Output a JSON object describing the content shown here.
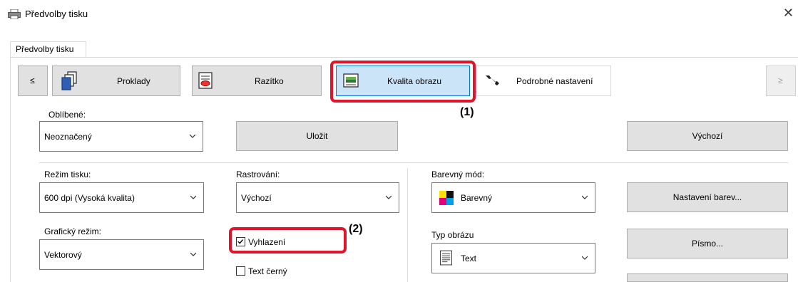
{
  "window": {
    "title": "Předvolby tisku",
    "close_glyph": "✕"
  },
  "tabs": [
    {
      "label": "Předvolby tisku"
    }
  ],
  "nav": {
    "prev": "≤",
    "next": "≥",
    "items": [
      {
        "label": "Proklady",
        "icon": "layers-icon"
      },
      {
        "label": "Razítko",
        "icon": "stamp-icon"
      },
      {
        "label": "Kvalita obrazu",
        "icon": "image-quality-icon",
        "selected": true
      },
      {
        "label": "Podrobné nastavení",
        "icon": "wrench-icon"
      }
    ]
  },
  "favorites": {
    "label": "Oblíbené:",
    "value": "Neoznačený",
    "save_label": "Uložit",
    "default_label": "Výchozí"
  },
  "print_mode": {
    "label": "Režim tisku:",
    "value": "600 dpi (Vysoká kvalita)"
  },
  "rasterization": {
    "label": "Rastrování:",
    "value": "Výchozí"
  },
  "color_mode": {
    "label": "Barevný mód:",
    "value": "Barevný",
    "settings_label": "Nastavení barev..."
  },
  "graphics_mode": {
    "label": "Grafický režim:",
    "value": "Vektorový"
  },
  "smoothing": {
    "label": "Vyhlazení",
    "checked": true
  },
  "black_text": {
    "label": "Text černý",
    "checked": false
  },
  "image_type": {
    "label": "Typ obrázu",
    "value": "Text"
  },
  "font_button": {
    "label": "Písmo..."
  },
  "callouts": {
    "one": "(1)",
    "two": "(2)"
  },
  "accent_color": "#e0142b"
}
